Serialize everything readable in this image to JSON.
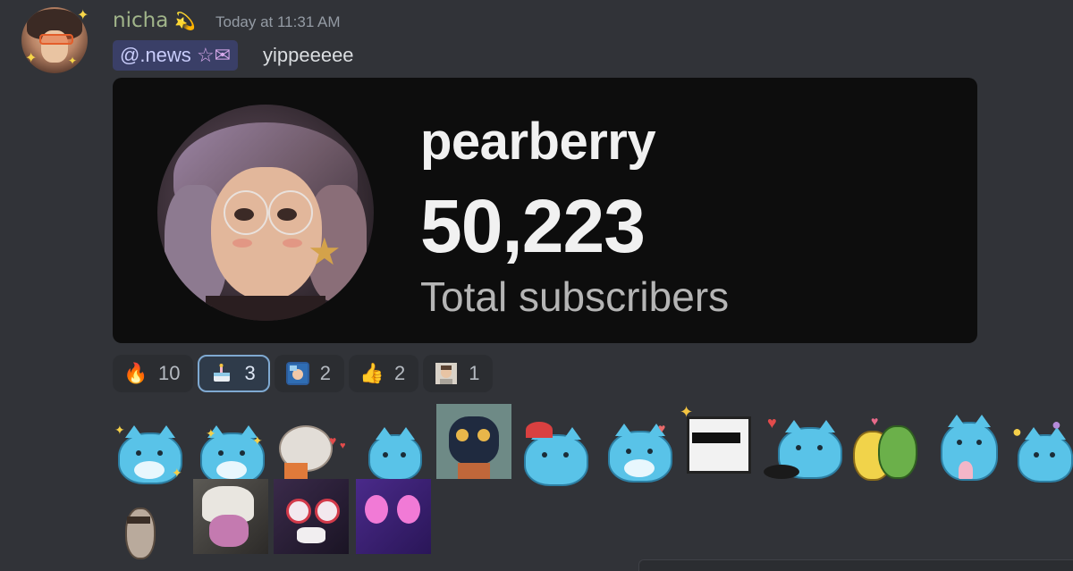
{
  "message": {
    "author": "nicha",
    "author_emoji": "💫",
    "timestamp": "Today at 11:31 AM",
    "role_mention": "@.news",
    "role_icons": "☆✉",
    "text": "yippeeeee"
  },
  "embed": {
    "name": "pearberry",
    "count": "50,223",
    "label": "Total subscribers"
  },
  "reactions": [
    {
      "emoji": "🔥",
      "count": "10",
      "active": false
    },
    {
      "emoji": "cake-icon",
      "count": "3",
      "active": true
    },
    {
      "emoji": "custom-emoji",
      "count": "2",
      "active": false
    },
    {
      "emoji": "👍",
      "count": "2",
      "active": false
    },
    {
      "emoji": "custom-photo-emoji",
      "count": "1",
      "active": false
    }
  ],
  "colors": {
    "background": "#313338",
    "username": "#a1b58a",
    "embed_bg": "#0d0d0d",
    "active_reaction_border": "#7fa9d1",
    "sticker_blue": "#59c3e8"
  }
}
